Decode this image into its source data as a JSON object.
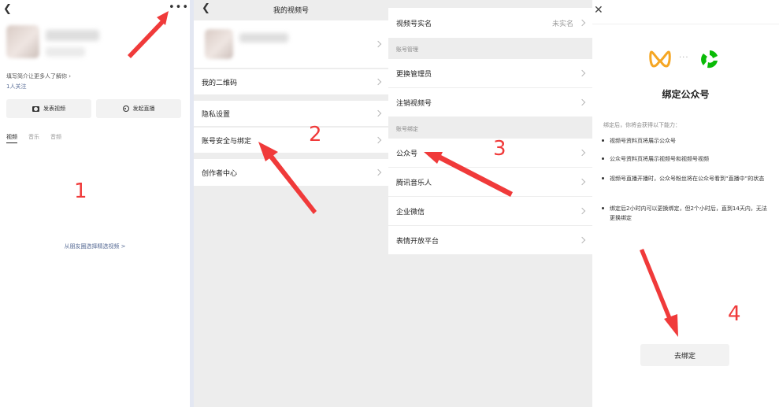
{
  "panel1": {
    "bio": "填写简介让更多人了解你",
    "follow": "1人关注",
    "publish_video": "发表视频",
    "start_live": "发起直播",
    "tabs": [
      "视频",
      "音乐",
      "音频"
    ],
    "moments_link": "从朋友圈选择精选视频 >",
    "step": "1"
  },
  "panel2": {
    "title": "我的视频号",
    "items": [
      "我的二维码",
      "隐私设置",
      "账号安全与绑定",
      "创作者中心"
    ],
    "step": "2"
  },
  "panel3": {
    "realname": {
      "label": "视频号实名",
      "value": "未实名"
    },
    "section_manage": "账号管理",
    "manage_items": [
      "更换管理员",
      "注销视频号"
    ],
    "section_bind": "账号绑定",
    "bind_items": [
      "公众号",
      "腾讯音乐人",
      "企业微信",
      "表情开放平台"
    ],
    "step": "3"
  },
  "panel4": {
    "title": "绑定公众号",
    "intro": "绑定后，你将会获得以下能力：",
    "bullets": [
      "视频号资料页将展示公众号",
      "公众号资料页将展示视频号和视频号视频",
      "视频号直播开播时，公众号粉丝将在公众号看到“直播中”的状态",
      "绑定后2小时内可以更换绑定，但2个小时后，直到14天内，无法更换绑定"
    ],
    "button": "去绑定",
    "step": "4"
  },
  "colors": {
    "annotation": "#f03a3a",
    "link": "#576b95",
    "list_bg": "#ededed"
  }
}
